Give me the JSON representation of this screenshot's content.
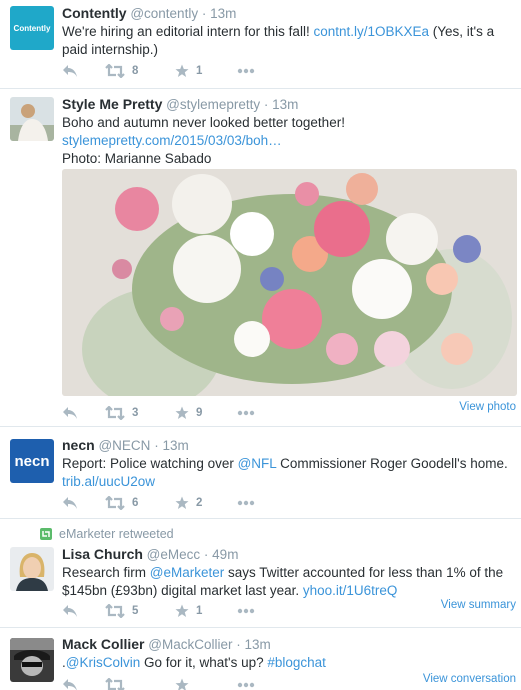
{
  "tweets": [
    {
      "name": "Contently",
      "handle": "@contently",
      "time": "13m",
      "text_parts": [
        "We're hiring an editorial intern for this fall! ",
        "contnt.ly/1OBKXEa",
        " (Yes, it's a paid internship.)"
      ],
      "retweets": "8",
      "favorites": "1",
      "avatar_text": "Contently",
      "avatar_color": "#1fa8c9"
    },
    {
      "name": "Style Me Pretty",
      "handle": "@stylemepretty",
      "time": "13m",
      "line1": "Boho and autumn never looked better together!",
      "link": "stylemepretty.com/2015/03/03/boh…",
      "line3": "Photo: Marianne Sabado",
      "retweets": "3",
      "favorites": "9",
      "view_label": "View photo"
    },
    {
      "name": "necn",
      "handle": "@NECN",
      "time": "13m",
      "text_parts": [
        "Report: Police watching over ",
        "@NFL",
        " Commissioner Roger Goodell's home."
      ],
      "link": "trib.al/uucU2ow",
      "retweets": "6",
      "favorites": "2",
      "avatar_text": "necn",
      "avatar_color": "#1e5fae"
    },
    {
      "retweeted_by": "eMarketer retweeted",
      "name": "Lisa Church",
      "handle": "@eMecc",
      "time": "49m",
      "text_parts": [
        "Research firm ",
        "@eMarketer",
        " says Twitter accounted for less than 1% of the $145bn (£93bn) digital market last year. ",
        "yhoo.it/1U6treQ"
      ],
      "retweets": "5",
      "favorites": "1",
      "view_label": "View summary"
    },
    {
      "name": "Mack Collier",
      "handle": "@MackCollier",
      "time": "13m",
      "text_parts": [
        ".",
        "@KrisColvin",
        " Go for it, what's up? ",
        "#blogchat"
      ],
      "view_label": "View conversation"
    }
  ],
  "dot": "·",
  "colors": {
    "link": "#3b94d9",
    "muted": "#8899a6",
    "retweet_green": "#5bbb6b"
  }
}
